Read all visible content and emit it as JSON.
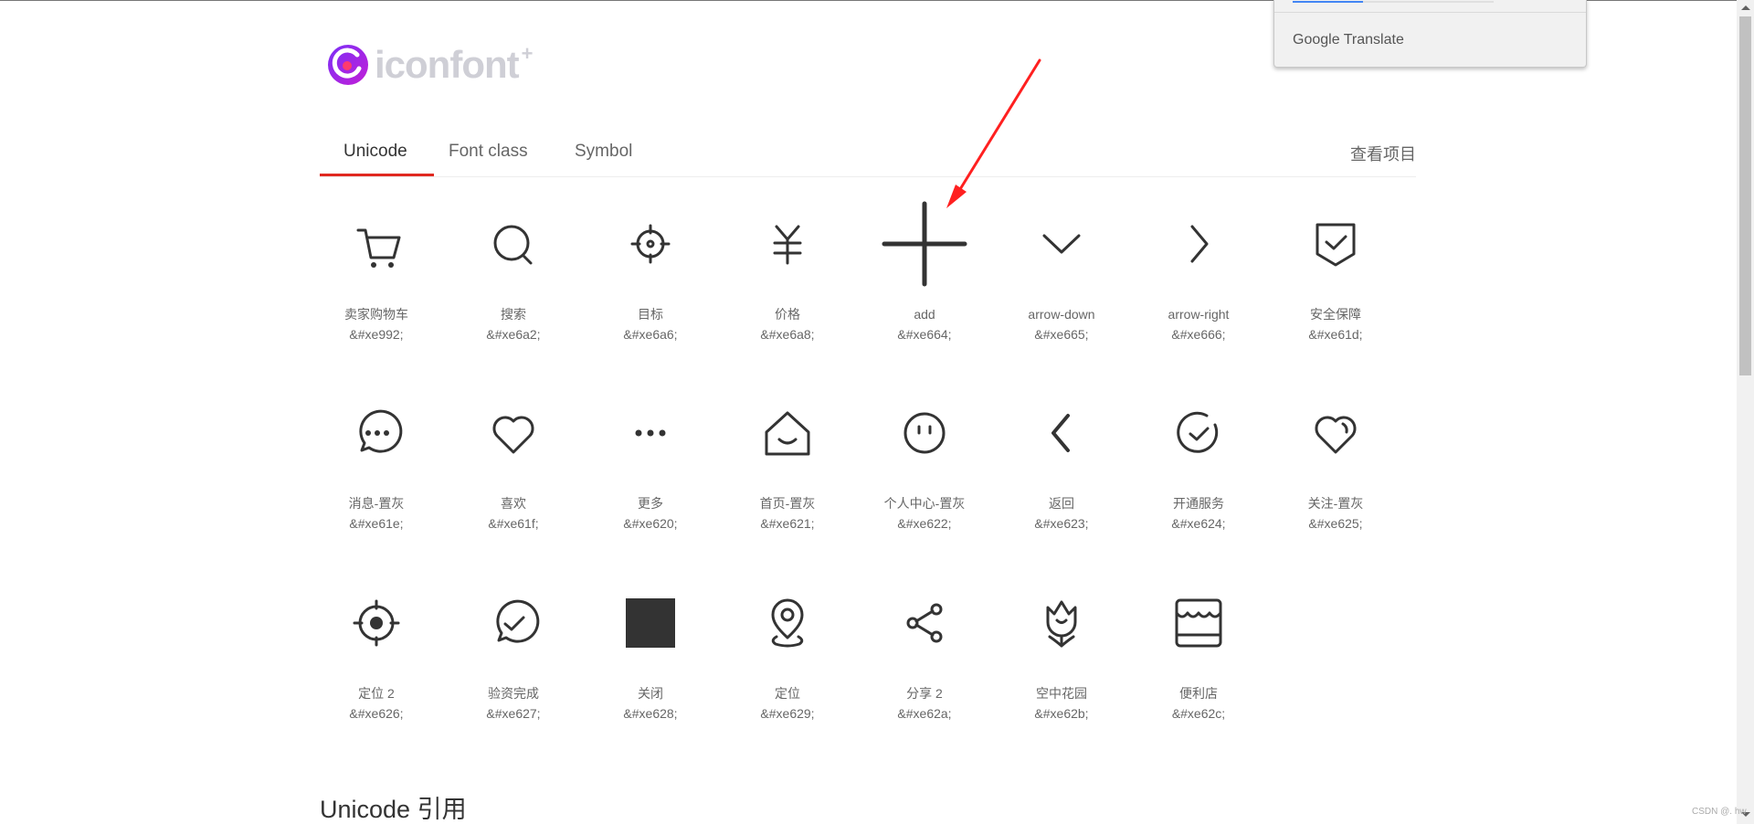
{
  "logo": {
    "text": "iconfont",
    "plus": "+"
  },
  "tabs": [
    {
      "label": "Unicode",
      "active": true
    },
    {
      "label": "Font class",
      "active": false
    },
    {
      "label": "Symbol",
      "active": false
    }
  ],
  "view_project_label": "查看项目",
  "icons": [
    {
      "name": "卖家购物车",
      "code": "&#xe992;",
      "icon": "cart-icon"
    },
    {
      "name": "搜索",
      "code": "&#xe6a2;",
      "icon": "search-icon"
    },
    {
      "name": "目标",
      "code": "&#xe6a6;",
      "icon": "target-icon"
    },
    {
      "name": "价格",
      "code": "&#xe6a8;",
      "icon": "yuan-icon"
    },
    {
      "name": "add",
      "code": "&#xe664;",
      "icon": "add-icon"
    },
    {
      "name": "arrow-down",
      "code": "&#xe665;",
      "icon": "arrow-down-icon"
    },
    {
      "name": "arrow-right",
      "code": "&#xe666;",
      "icon": "arrow-right-icon"
    },
    {
      "name": "安全保障",
      "code": "&#xe61d;",
      "icon": "shield-check-icon"
    },
    {
      "name": "消息-置灰",
      "code": "&#xe61e;",
      "icon": "message-icon"
    },
    {
      "name": "喜欢",
      "code": "&#xe61f;",
      "icon": "heart-icon"
    },
    {
      "name": "更多",
      "code": "&#xe620;",
      "icon": "more-icon"
    },
    {
      "name": "首页-置灰",
      "code": "&#xe621;",
      "icon": "home-icon"
    },
    {
      "name": "个人中心-置灰",
      "code": "&#xe622;",
      "icon": "user-face-icon"
    },
    {
      "name": "返回",
      "code": "&#xe623;",
      "icon": "back-icon"
    },
    {
      "name": "开通服务",
      "code": "&#xe624;",
      "icon": "check-circle-icon"
    },
    {
      "name": "关注-置灰",
      "code": "&#xe625;",
      "icon": "heart-follow-icon"
    },
    {
      "name": "定位 2",
      "code": "&#xe626;",
      "icon": "locate-icon"
    },
    {
      "name": "验资完成",
      "code": "&#xe627;",
      "icon": "verified-message-icon"
    },
    {
      "name": "关闭",
      "code": "&#xe628;",
      "icon": "close-square-icon"
    },
    {
      "name": "定位",
      "code": "&#xe629;",
      "icon": "map-pin-icon"
    },
    {
      "name": "分享 2",
      "code": "&#xe62a;",
      "icon": "share-icon"
    },
    {
      "name": "空中花园",
      "code": "&#xe62b;",
      "icon": "flower-icon"
    },
    {
      "name": "便利店",
      "code": "&#xe62c;",
      "icon": "store-icon"
    }
  ],
  "section_heading": "Unicode 引用",
  "translate_popup": {
    "brand": "Google Translate",
    "progress": 0.35
  },
  "watermark": "CSDN @. hw",
  "colors": {
    "accent": "#e0281f",
    "icon": "#333333",
    "arrow": "#ff2020"
  }
}
